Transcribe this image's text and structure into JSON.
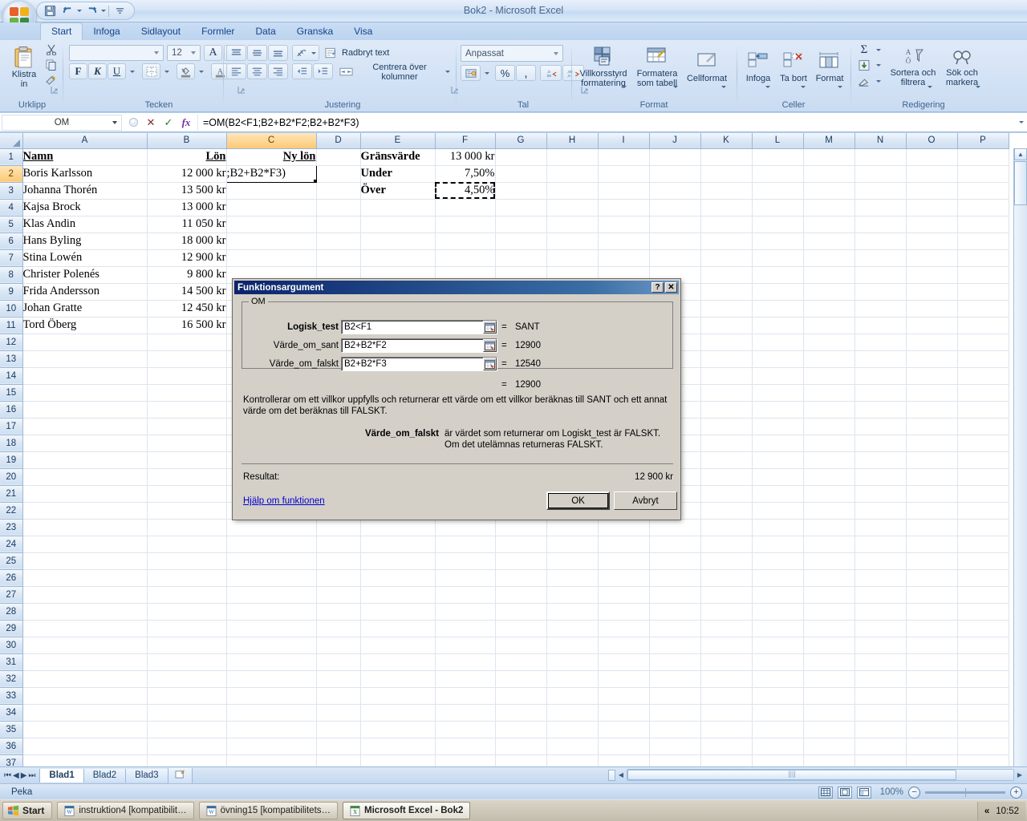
{
  "window": {
    "title": "Bok2 - Microsoft Excel",
    "help_icon": "help-icon",
    "minimize": "–",
    "restore": "❐",
    "close": "✕"
  },
  "quick_access": {
    "save": "save-icon",
    "undo": "undo-icon",
    "redo": "redo-icon",
    "customize": "customize-icon"
  },
  "ribbon": {
    "tabs": [
      {
        "label": "Start",
        "active": true
      },
      {
        "label": "Infoga",
        "active": false
      },
      {
        "label": "Sidlayout",
        "active": false
      },
      {
        "label": "Formler",
        "active": false
      },
      {
        "label": "Data",
        "active": false
      },
      {
        "label": "Granska",
        "active": false
      },
      {
        "label": "Visa",
        "active": false
      }
    ],
    "groups": {
      "clipboard": {
        "label": "Urklipp",
        "paste": "Klistra in",
        "cut": "cut-icon",
        "copy": "copy-icon",
        "format_painter": "format-painter-icon"
      },
      "font": {
        "label": "Tecken",
        "font_name": "",
        "font_size": "12",
        "grow_font": "A",
        "shrink_font": "A",
        "bold": "F",
        "italic": "K",
        "underline": "U",
        "borders": "borders-icon",
        "fill_color": "fill-color-icon",
        "font_color": "font-color-icon"
      },
      "alignment": {
        "label": "Justering",
        "wrap_text": "Radbryt text",
        "merge_center": "Centrera över kolumner",
        "orientation": "orientation-icon"
      },
      "number": {
        "label": "Tal",
        "format": "Anpassat",
        "currency": "currency-icon",
        "percent": "%",
        "comma": ",",
        "decrease_decimal": "decrease-decimal-icon",
        "increase_decimal": "increase-decimal-icon"
      },
      "styles": {
        "label": "Format",
        "conditional": "Villkorsstyrd formatering",
        "as_table": "Formatera som tabell",
        "cell_styles": "Cellformat"
      },
      "cells": {
        "label": "Celler",
        "insert": "Infoga",
        "delete": "Ta bort",
        "format": "Format"
      },
      "editing": {
        "label": "Redigering",
        "autosum": "Σ",
        "fill": "fill-down-icon",
        "clear": "clear-icon",
        "sort_filter": "Sortera och filtrera",
        "find_select": "Sök och markera"
      }
    }
  },
  "formula_bar": {
    "name_box": "OM",
    "cancel": "✕",
    "enter": "✓",
    "insert_function": "fx",
    "formula": "=OM(B2<F1;B2+B2*F2;B2+B2*F3)"
  },
  "grid": {
    "columns": [
      "A",
      "B",
      "C",
      "D",
      "E",
      "F",
      "G",
      "H",
      "I",
      "J",
      "K",
      "L",
      "M",
      "N",
      "O",
      "P"
    ],
    "selected_column": "C",
    "selected_row": 2,
    "rows": [
      {
        "n": 1,
        "A": "Namn",
        "B": "Lön",
        "C": "Ny lön",
        "E": "Gränsvärde",
        "F": "13 000 kr"
      },
      {
        "n": 2,
        "A": "Boris Karlsson",
        "B": "12 000 kr",
        "C": ";B2+B2*F3)",
        "E": "Under",
        "F": "7,50%"
      },
      {
        "n": 3,
        "A": "Johanna Thorén",
        "B": "13 500 kr",
        "C": "",
        "E": "Över",
        "F": "4,50%"
      },
      {
        "n": 4,
        "A": "Kajsa Brock",
        "B": "13 000 kr",
        "C": "",
        "E": "",
        "F": ""
      },
      {
        "n": 5,
        "A": "Klas Andin",
        "B": "11 050 kr",
        "C": "",
        "E": "",
        "F": ""
      },
      {
        "n": 6,
        "A": "Hans Byling",
        "B": "18 000 kr",
        "C": "",
        "E": "",
        "F": ""
      },
      {
        "n": 7,
        "A": "Stina Lowén",
        "B": "12 900 kr",
        "C": "",
        "E": "",
        "F": ""
      },
      {
        "n": 8,
        "A": "Christer Polenés",
        "B": "9 800 kr",
        "C": "",
        "E": "",
        "F": ""
      },
      {
        "n": 9,
        "A": "Frida Andersson",
        "B": "14 500 kr",
        "C": "",
        "E": "",
        "F": ""
      },
      {
        "n": 10,
        "A": "Johan Gratte",
        "B": "12 450 kr",
        "C": "",
        "E": "",
        "F": ""
      },
      {
        "n": 11,
        "A": "Tord Öberg",
        "B": "16 500 kr",
        "C": "",
        "E": "",
        "F": ""
      },
      {
        "n": 12
      },
      {
        "n": 13
      },
      {
        "n": 14
      },
      {
        "n": 15
      },
      {
        "n": 16
      },
      {
        "n": 17
      },
      {
        "n": 18
      },
      {
        "n": 19
      },
      {
        "n": 20
      },
      {
        "n": 21
      },
      {
        "n": 22
      },
      {
        "n": 23
      },
      {
        "n": 24
      },
      {
        "n": 25
      },
      {
        "n": 26
      },
      {
        "n": 27
      },
      {
        "n": 28
      },
      {
        "n": 29
      },
      {
        "n": 30
      },
      {
        "n": 31
      },
      {
        "n": 32
      },
      {
        "n": 33
      },
      {
        "n": 34
      },
      {
        "n": 35
      },
      {
        "n": 36
      },
      {
        "n": 37
      }
    ]
  },
  "dialog": {
    "title": "Funktionsargument",
    "help_btn": "?",
    "close_btn": "✕",
    "function_name": "OM",
    "args": [
      {
        "label": "Logisk_test",
        "value": "B2<F1",
        "result": "SANT",
        "bold": true
      },
      {
        "label": "Värde_om_sant",
        "value": "B2+B2*F2",
        "result": "12900",
        "bold": false
      },
      {
        "label": "Värde_om_falskt",
        "value": "B2+B2*F3",
        "result": "12540",
        "bold": false
      }
    ],
    "eq": "=",
    "overall_result": "12900",
    "description": "Kontrollerar om ett villkor uppfylls och returnerar ett värde om ett villkor beräknas till SANT och ett annat värde om det beräknas till FALSKT.",
    "arg_help_name": "Värde_om_falskt",
    "arg_help_text": "är värdet som returnerar om Logiskt_test är FALSKT. Om det utelämnas returneras FALSKT.",
    "result_label": "Resultat:",
    "result_value": "12 900 kr",
    "help_link": "Hjälp om funktionen",
    "ok": "OK",
    "cancel": "Avbryt"
  },
  "sheet_tabs": {
    "first": "⏮",
    "prev": "◀",
    "next": "▶",
    "last": "⏭",
    "tabs": [
      {
        "label": "Blad1",
        "active": true
      },
      {
        "label": "Blad2",
        "active": false
      },
      {
        "label": "Blad3",
        "active": false
      }
    ],
    "insert_sheet": "insert-sheet-icon"
  },
  "status_bar": {
    "mode": "Peka",
    "view_normal": "normal-view-icon",
    "view_layout": "page-layout-icon",
    "view_break": "page-break-icon",
    "zoom": "100%",
    "zoom_out": "−",
    "zoom_in": "+"
  },
  "taskbar": {
    "start": "Start",
    "items": [
      {
        "label": "instruktion4 [kompatibilit…",
        "icon": "word-icon",
        "active": false
      },
      {
        "label": "övning15 [kompatibilitets…",
        "icon": "word-icon",
        "active": false
      },
      {
        "label": "Microsoft Excel - Bok2",
        "icon": "excel-icon",
        "active": true
      }
    ],
    "tray_expand": "«",
    "clock": "10:52"
  },
  "colors": {
    "accent": "#15428b",
    "selection": "#fcc977",
    "dialog_titlebar": "#0a246a",
    "link": "#0000cc"
  }
}
